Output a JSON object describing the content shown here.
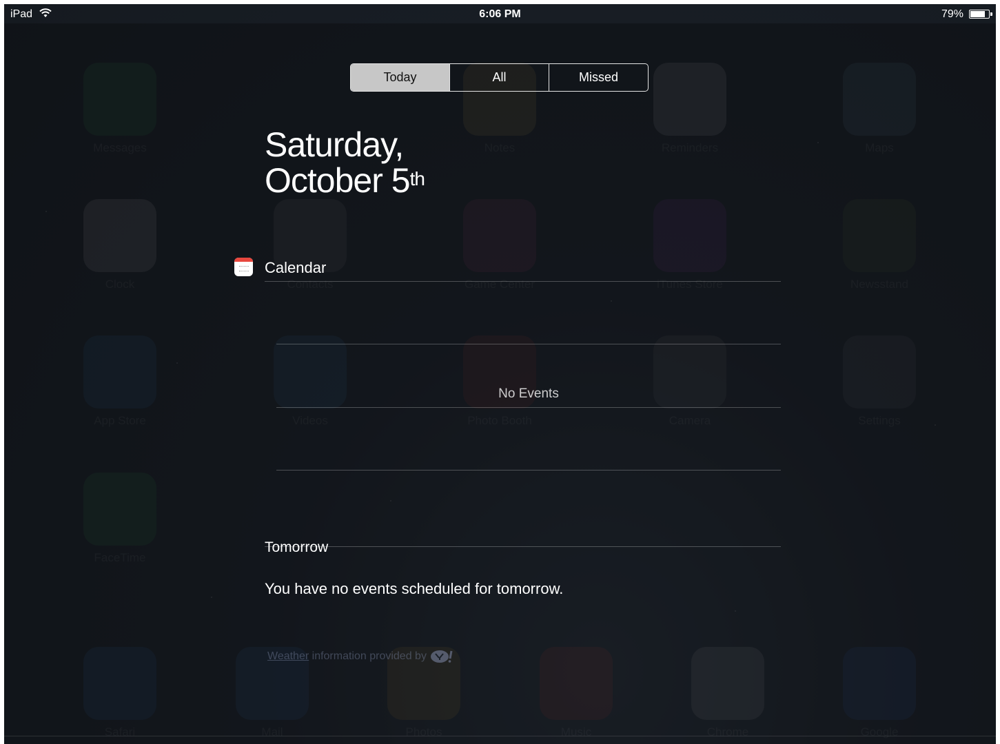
{
  "status_bar": {
    "carrier": "iPad",
    "time": "6:06 PM",
    "battery_percent": "79%"
  },
  "background_apps": [
    {
      "label": "Messages",
      "color": "#34c759"
    },
    {
      "label": "Notes",
      "color": "#f5d060"
    },
    {
      "label": "Reminders",
      "color": "#ffffff"
    },
    {
      "label": "Maps",
      "color": "#7fb3d8"
    },
    {
      "label": "Clock",
      "color": "#ffffff"
    },
    {
      "label": "Contacts",
      "color": "#b0b0b0"
    },
    {
      "label": "Game Center",
      "color": "#e04b8f"
    },
    {
      "label": "iTunes Store",
      "color": "#c044d8"
    },
    {
      "label": "Newsstand",
      "color": "#6b8f3a"
    },
    {
      "label": "App Store",
      "color": "#2f8ce0"
    },
    {
      "label": "Videos",
      "color": "#3f9fe0"
    },
    {
      "label": "Photo Booth",
      "color": "#d93a2f"
    },
    {
      "label": "Camera",
      "color": "#9a9a9a"
    },
    {
      "label": "Settings",
      "color": "#8e8e93"
    },
    {
      "label": "FaceTime",
      "color": "#34c759"
    },
    {
      "label": "Safari",
      "color": "#3a8ee6"
    },
    {
      "label": "Mail",
      "color": "#3a8ee6"
    },
    {
      "label": "Photos",
      "color": "#f2b23a"
    },
    {
      "label": "Music",
      "color": "#f0433a"
    },
    {
      "label": "Chrome",
      "color": "#e9e9e9"
    },
    {
      "label": "Google",
      "color": "#3a7ee6"
    }
  ],
  "tabs": [
    {
      "label": "Today",
      "active": true
    },
    {
      "label": "All",
      "active": false
    },
    {
      "label": "Missed",
      "active": false
    }
  ],
  "date": {
    "weekday": "Saturday,",
    "month_day": "October 5",
    "suffix": "th"
  },
  "calendar": {
    "title": "Calendar",
    "no_events": "No Events"
  },
  "tomorrow": {
    "title": "Tomorrow",
    "message": "You have no events scheduled for tomorrow."
  },
  "weather": {
    "link": "Weather",
    "text": " information provided by "
  },
  "colors": {
    "calendar_accent": "#e8473e",
    "active_tab": "#c7c7c7"
  }
}
